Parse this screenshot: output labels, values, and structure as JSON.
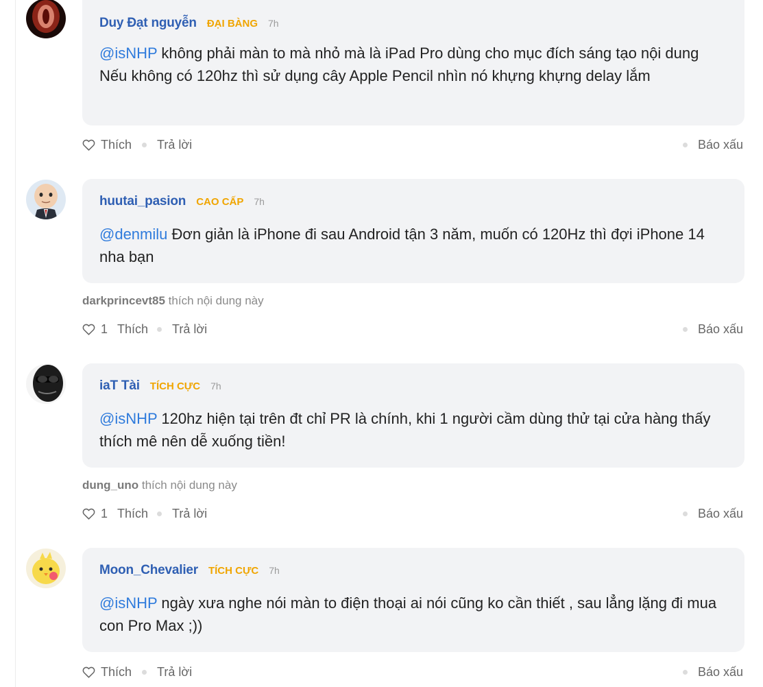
{
  "comments": [
    {
      "author": "Duy Đạt nguyễn",
      "rank": "ĐẠI BÀNG",
      "time": "7h",
      "mention": "@isNHP",
      "text": " không phải màn to mà nhỏ mà là iPad Pro dùng cho mục đích sáng tạo nội dung",
      "text2": "Nếu không có 120hz thì sử dụng cây Apple Pencil nhìn nó khựng khựng delay lắm",
      "like_count": "",
      "like_label": "Thích",
      "reply_label": "Trả lời",
      "report_label": "Báo xấu"
    },
    {
      "author": "huutai_pasion",
      "rank": "CAO CẤP",
      "time": "7h",
      "mention": "@denmilu",
      "text": " Đơn giản là iPhone đi sau Android tận 3 năm, muốn có 120Hz thì đợi iPhone 14 nha bạn",
      "liker": "darkprincevt85",
      "liker_suffix": " thích nội dung này",
      "like_count": "1",
      "like_label": "Thích",
      "reply_label": "Trả lời",
      "report_label": "Báo xấu"
    },
    {
      "author": "iaT Tài",
      "rank": "TÍCH CỰC",
      "time": "7h",
      "mention": "@isNHP",
      "text": " 120hz hiện tại trên đt chỉ PR là chính, khi 1 người cầm dùng thử tại cửa hàng thấy thích mê nên dễ xuống tiền!",
      "liker": "dung_uno",
      "liker_suffix": " thích nội dung này",
      "like_count": "1",
      "like_label": "Thích",
      "reply_label": "Trả lời",
      "report_label": "Báo xấu"
    },
    {
      "author": "Moon_Chevalier",
      "rank": "TÍCH CỰC",
      "time": "7h",
      "mention": "@isNHP",
      "text": " ngày xưa nghe nói màn to điện thoại ai nói cũng ko cần thiết , sau lẳng lặng đi mua con Pro Max ;))",
      "like_count": "",
      "like_label": "Thích",
      "reply_label": "Trả lời",
      "report_label": "Báo xấu"
    }
  ],
  "colors": {
    "author": "#2f5fb3",
    "mention": "#2f7bdc",
    "rank": "#f0a500",
    "bubble": "#f2f3f5"
  },
  "icons": {
    "like": "heart-outline-icon",
    "separator": "dot"
  }
}
